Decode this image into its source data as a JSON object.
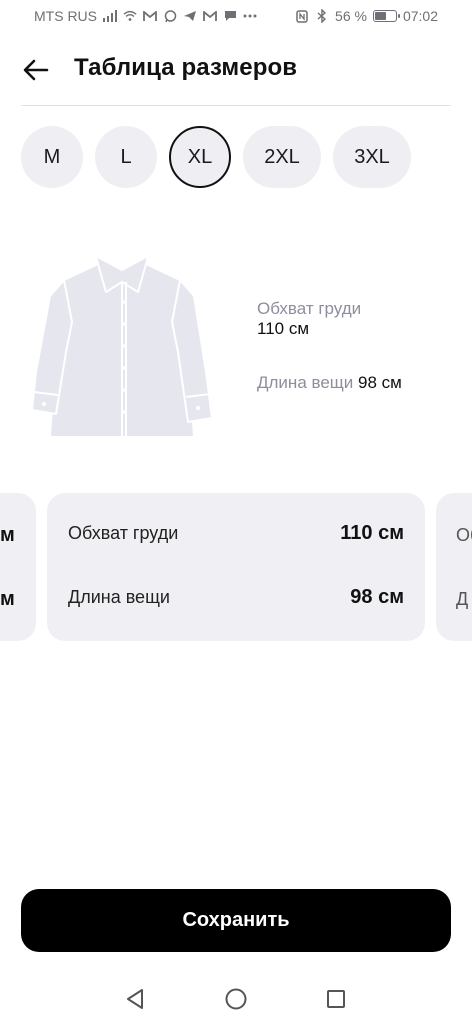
{
  "status_bar": {
    "carrier": "MTS RUS",
    "battery_text": "56 %",
    "battery_level": 0.56,
    "time": "07:02",
    "left_icons": [
      "signal-icon",
      "wifi-icon",
      "gmail-icon",
      "whatsapp-icon",
      "telegram-icon",
      "gmail-icon",
      "chat-icon",
      "more-icon"
    ],
    "right_icons": [
      "nfc-icon",
      "bluetooth-icon",
      "battery-icon"
    ]
  },
  "header": {
    "title": "Таблица размеров",
    "back_icon": "arrow-left-icon"
  },
  "sizes": [
    {
      "label": "M",
      "selected": false
    },
    {
      "label": "L",
      "selected": false
    },
    {
      "label": "XL",
      "selected": true
    },
    {
      "label": "2XL",
      "selected": false
    },
    {
      "label": "3XL",
      "selected": false
    }
  ],
  "illustration": {
    "icon": "shirt-icon",
    "chest_label": "Обхват груди",
    "chest_value": "110 см",
    "length_label": "Длина вещи",
    "length_value": "98 см"
  },
  "cards": {
    "prev": {
      "row1_value_fragment": "м",
      "row2_value_fragment": "м"
    },
    "current": {
      "rows": [
        {
          "label": "Обхват груди",
          "value": "110 см"
        },
        {
          "label": "Длина вещи",
          "value": "98 см"
        }
      ]
    },
    "next": {
      "row1_label_fragment": "Об",
      "row2_label_fragment": "Д"
    }
  },
  "save_button": {
    "label": "Сохранить"
  },
  "navbar": {
    "icons": [
      "back-triangle-icon",
      "home-circle-icon",
      "recents-square-icon"
    ]
  },
  "colors": {
    "chip_bg": "#eeeef3",
    "card_bg": "#f0f0f4",
    "muted_text": "#8e8e9c",
    "button_bg": "#000000",
    "button_text": "#ffffff"
  }
}
